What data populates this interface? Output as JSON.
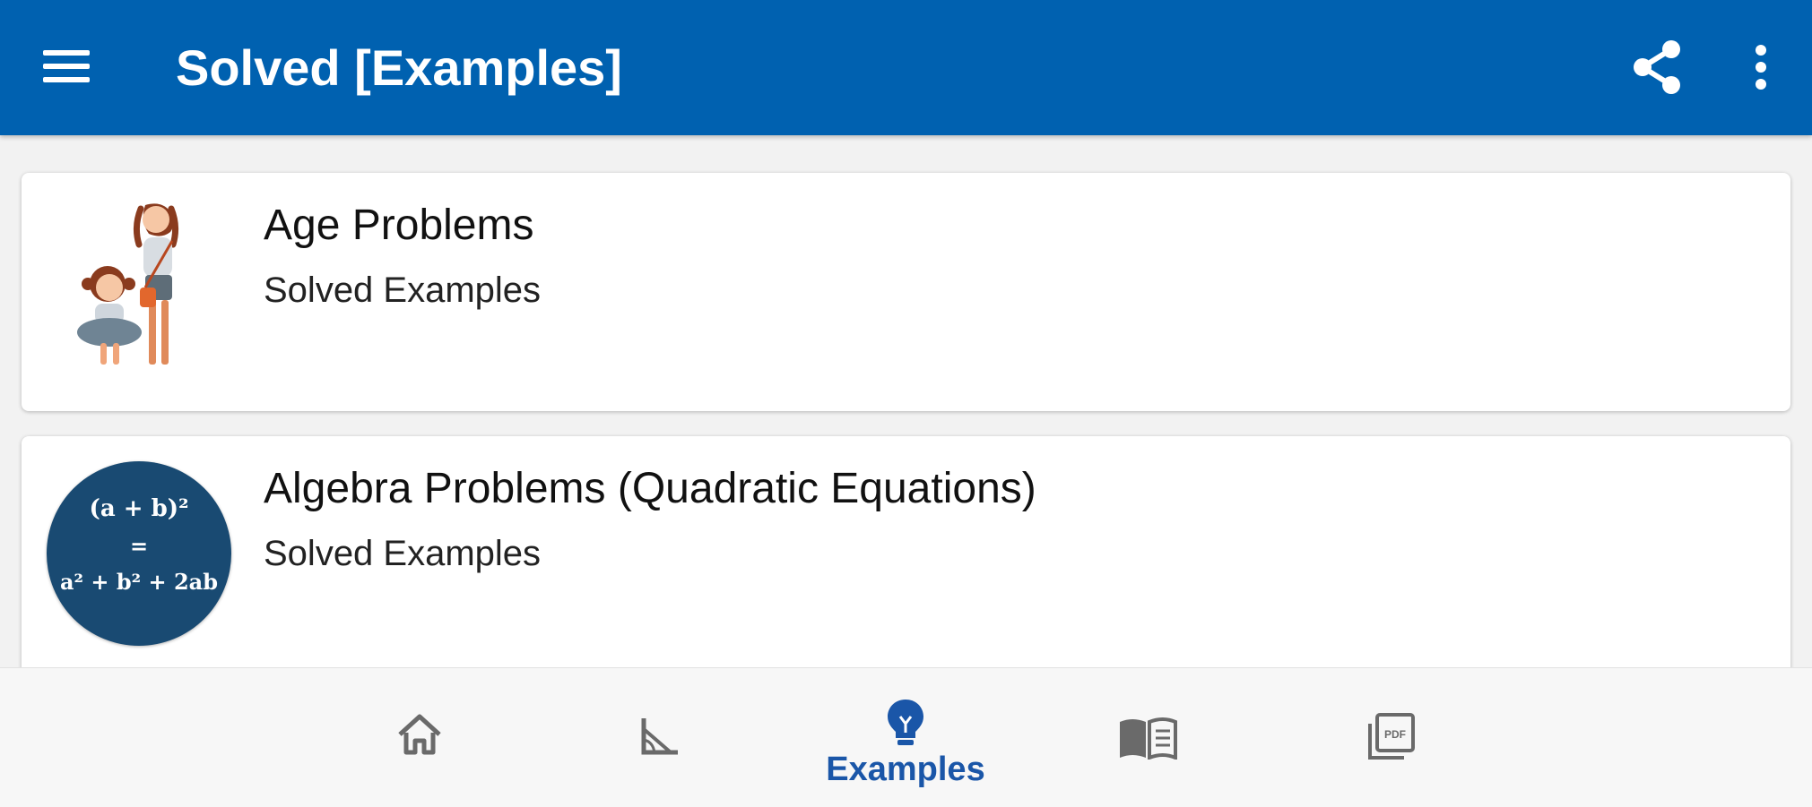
{
  "app_bar": {
    "title": "Solved [Examples]",
    "menu_icon": "hamburger-menu-icon",
    "share_icon": "share-icon",
    "more_icon": "more-vert-icon"
  },
  "list": {
    "items": [
      {
        "title": "Age Problems",
        "subtitle": "Solved Examples",
        "image": "girls-illustration"
      },
      {
        "title": "Algebra Problems (Quadratic Equations)",
        "subtitle": "Solved Examples",
        "badge": {
          "line1": "(a + b)²",
          "line2": "=",
          "line3": "a² + b² + 2ab"
        }
      }
    ]
  },
  "bottom_nav": {
    "items": [
      {
        "icon": "home-icon",
        "label": "",
        "active": false
      },
      {
        "icon": "geometry-icon",
        "label": "",
        "active": false
      },
      {
        "icon": "lightbulb-icon",
        "label": "Examples",
        "active": true
      },
      {
        "icon": "book-icon",
        "label": "",
        "active": false
      },
      {
        "icon": "pdf-icon",
        "label": "",
        "active": false
      }
    ]
  },
  "colors": {
    "primary": "#0061b0",
    "accent": "#1a56a8",
    "inactive_icon": "#6a6a6a",
    "badge_bg": "#194a72"
  }
}
